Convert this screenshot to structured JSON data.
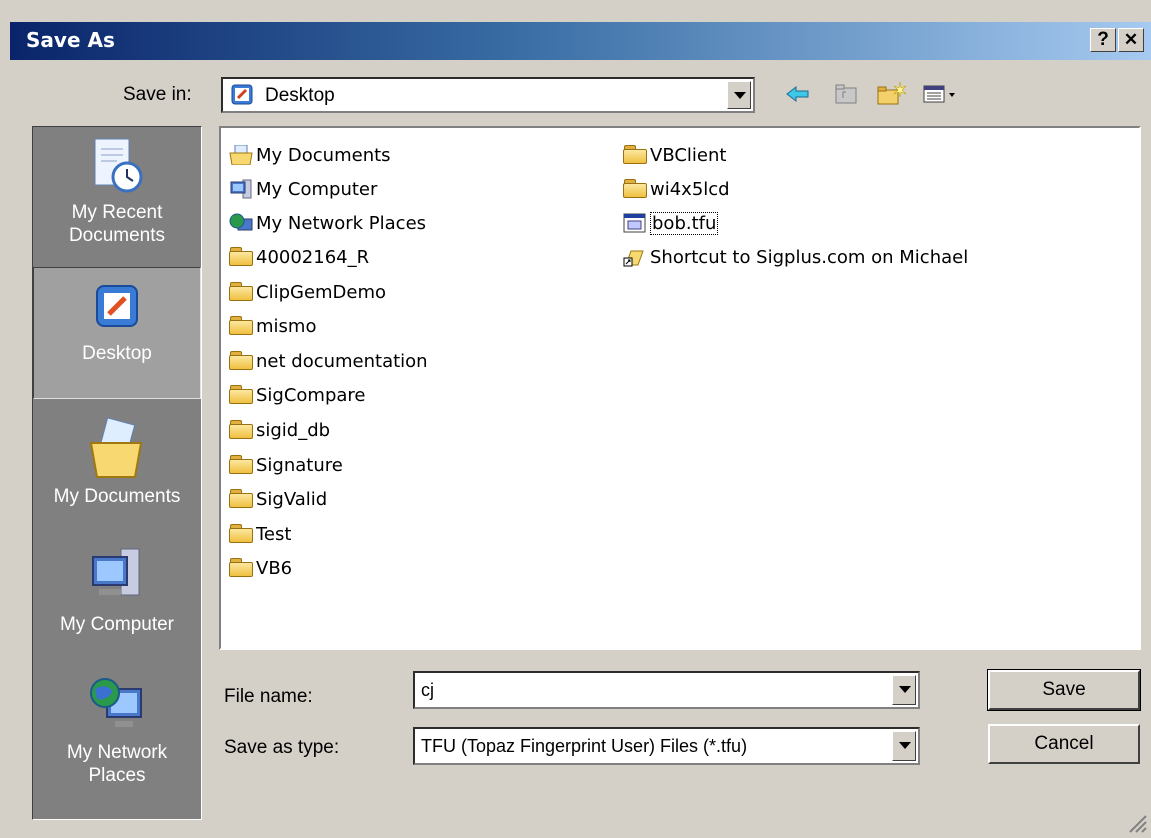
{
  "window": {
    "title": "Save As",
    "help_label": "?",
    "close_label": "✕"
  },
  "toolbar": {
    "save_in_label": "Save in:",
    "save_in_value": "Desktop"
  },
  "places": [
    {
      "label1": "My Recent",
      "label2": "Documents",
      "icon": "recent-documents-icon"
    },
    {
      "label1": "Desktop",
      "label2": "",
      "icon": "desktop-icon"
    },
    {
      "label1": "My Documents",
      "label2": "",
      "icon": "my-documents-icon"
    },
    {
      "label1": "My Computer",
      "label2": "",
      "icon": "my-computer-icon"
    },
    {
      "label1": "My Network",
      "label2": "Places",
      "icon": "my-network-places-icon"
    }
  ],
  "files_col1": [
    {
      "name": "My Documents",
      "icon": "my-documents-icon"
    },
    {
      "name": "My Computer",
      "icon": "my-computer-icon"
    },
    {
      "name": "My Network Places",
      "icon": "network-places-icon"
    },
    {
      "name": "40002164_R",
      "icon": "folder-icon"
    },
    {
      "name": "ClipGemDemo",
      "icon": "folder-icon"
    },
    {
      "name": "mismo",
      "icon": "folder-icon"
    },
    {
      "name": "net documentation",
      "icon": "folder-icon"
    },
    {
      "name": "SigCompare",
      "icon": "folder-icon"
    },
    {
      "name": "sigid_db",
      "icon": "folder-icon"
    },
    {
      "name": "Signature",
      "icon": "folder-icon"
    },
    {
      "name": "SigValid",
      "icon": "folder-icon"
    },
    {
      "name": "Test",
      "icon": "folder-icon"
    },
    {
      "name": "VB6",
      "icon": "folder-icon"
    }
  ],
  "files_col2": [
    {
      "name": "VBClient",
      "icon": "folder-icon"
    },
    {
      "name": "wi4x5lcd",
      "icon": "folder-icon"
    },
    {
      "name": "bob.tfu",
      "icon": "tfu-file-icon"
    },
    {
      "name": "Shortcut to Sigplus.com on Michael",
      "icon": "shortcut-icon"
    }
  ],
  "form": {
    "file_name_label": "File name:",
    "file_name_value": "cj",
    "save_type_label": "Save as type:",
    "save_type_value": "TFU (Topaz Fingerprint User) Files (*.tfu)",
    "save_button": "Save",
    "cancel_button": "Cancel"
  }
}
